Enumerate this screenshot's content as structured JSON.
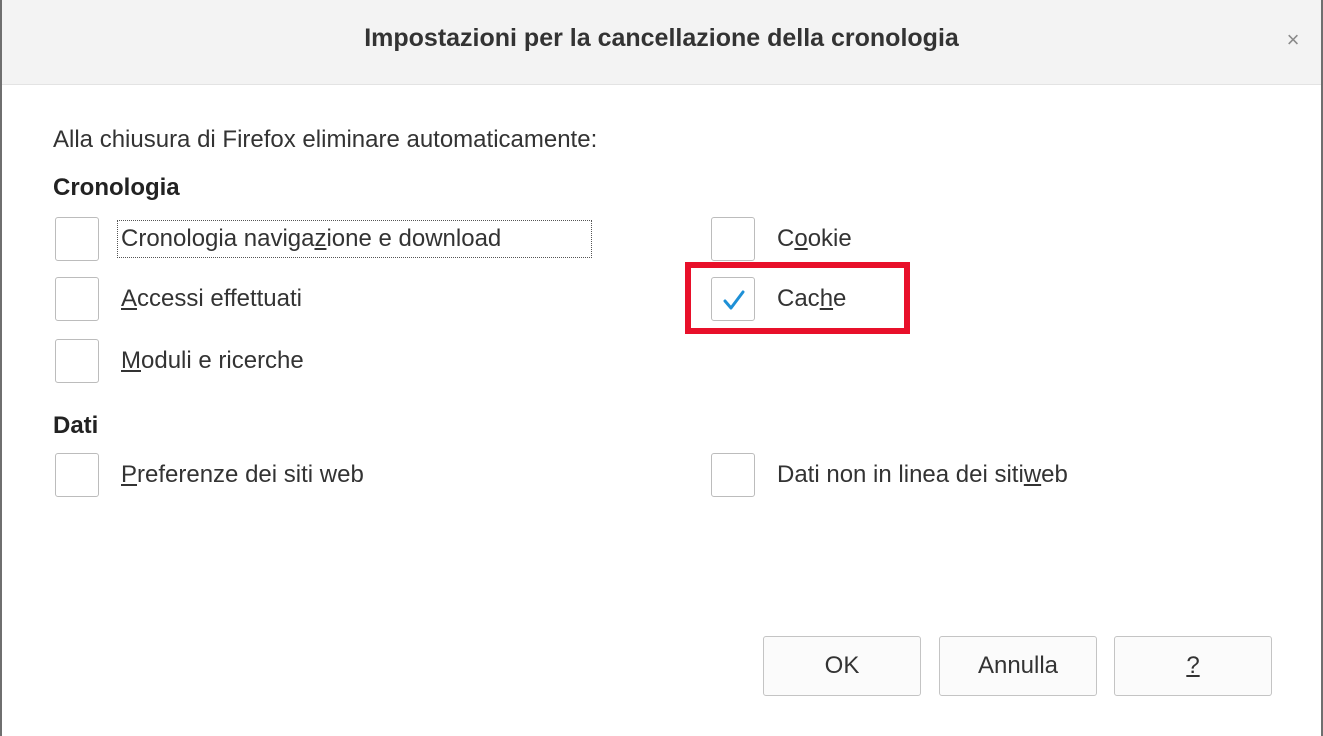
{
  "dialog": {
    "title": "Impostazioni per la cancellazione della cronologia",
    "close_label": "×",
    "intro": "Alla chiusura di Firefox eliminare automaticamente:"
  },
  "sections": {
    "history": {
      "title": "Cronologia",
      "items": {
        "browsing": {
          "pre": "Cronologia naviga",
          "key": "z",
          "post": "ione e download",
          "checked": false
        },
        "cookie": {
          "pre": "C",
          "key": "o",
          "post": "okie",
          "checked": false
        },
        "logins": {
          "pre": "",
          "key": "A",
          "post": "ccessi effettuati",
          "checked": false
        },
        "cache": {
          "pre": "Cac",
          "key": "h",
          "post": "e",
          "checked": true
        },
        "forms": {
          "pre": "",
          "key": "M",
          "post": "oduli e ricerche",
          "checked": false
        }
      }
    },
    "data": {
      "title": "Dati",
      "items": {
        "site_prefs": {
          "pre": "",
          "key": "P",
          "post": "referenze dei siti web",
          "checked": false
        },
        "offline": {
          "pre": "Dati non in linea dei siti ",
          "key": "w",
          "post": "eb",
          "checked": false
        }
      }
    }
  },
  "buttons": {
    "ok": "OK",
    "cancel": "Annulla",
    "help": "?"
  },
  "colors": {
    "check": "#1e90d6",
    "highlight": "#e8102a"
  }
}
